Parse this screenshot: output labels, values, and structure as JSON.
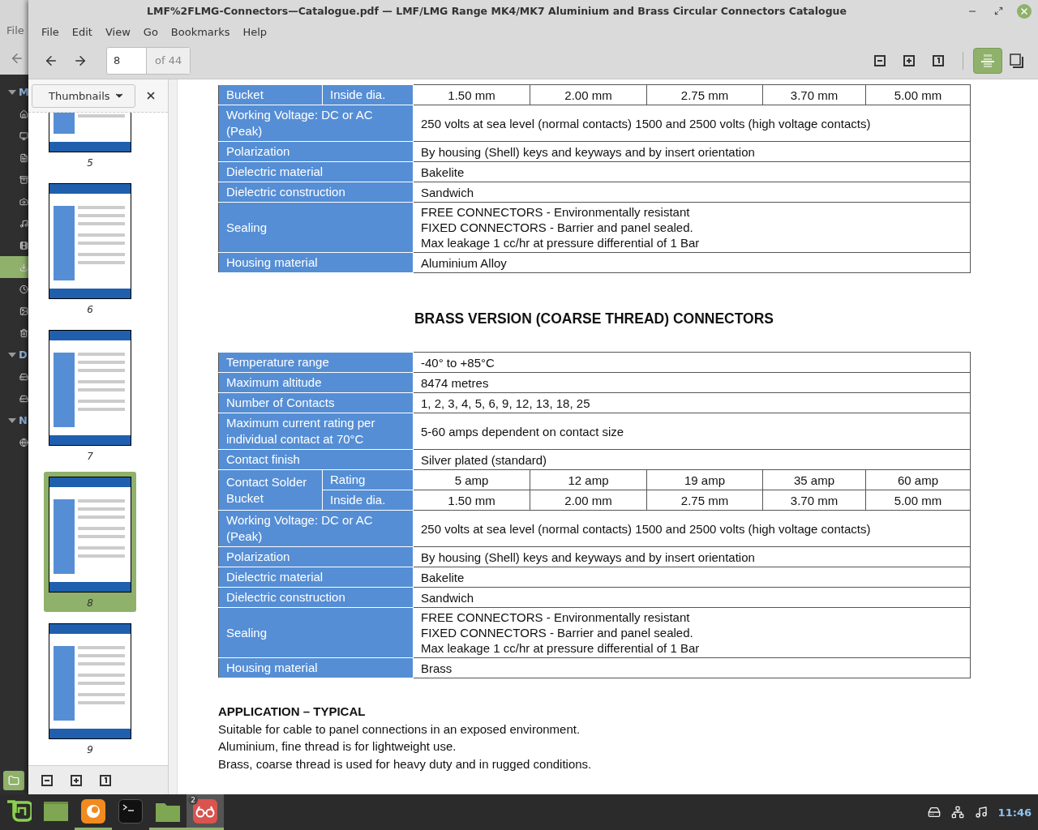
{
  "background_window": {
    "menu_item": "File",
    "sidebar": [
      {
        "kind": "header",
        "label": "M"
      },
      {
        "kind": "place",
        "selected": false
      },
      {
        "kind": "place",
        "selected": false
      },
      {
        "kind": "place",
        "selected": false
      },
      {
        "kind": "place",
        "selected": false
      },
      {
        "kind": "place",
        "selected": false
      },
      {
        "kind": "place",
        "selected": false
      },
      {
        "kind": "place",
        "selected": false
      },
      {
        "kind": "place",
        "selected": true
      },
      {
        "kind": "place",
        "selected": false
      },
      {
        "kind": "place",
        "selected": false
      },
      {
        "kind": "place",
        "selected": false
      },
      {
        "kind": "header",
        "label": "D"
      },
      {
        "kind": "place",
        "selected": false
      },
      {
        "kind": "place",
        "selected": false
      },
      {
        "kind": "header",
        "label": "N"
      },
      {
        "kind": "place",
        "selected": false
      }
    ]
  },
  "window": {
    "title": "LMF%2FLMG-Connectors—Catalogue.pdf — LMF/LMG Range MK4/MK7 Aluminium and Brass Circular Connectors Catalogue",
    "menu": [
      "File",
      "Edit",
      "View",
      "Go",
      "Bookmarks",
      "Help"
    ],
    "toolbar": {
      "page": "8",
      "page_total": "of 44",
      "continuous_selected": true
    },
    "sidebar": {
      "selector": "Thumbnails",
      "thumbnails": [
        {
          "page": "5",
          "selected": false
        },
        {
          "page": "6",
          "selected": false
        },
        {
          "page": "7",
          "selected": false
        },
        {
          "page": "8",
          "selected": true
        },
        {
          "page": "9",
          "selected": false
        }
      ]
    },
    "document": {
      "table_1": {
        "rows": [
          {
            "kind": "split",
            "label": "Bucket",
            "subrows": [
              {
                "label": "Inside dia.",
                "values": [
                  "1.50 mm",
                  "2.00 mm",
                  "2.75 mm",
                  "3.70 mm",
                  "5.00 mm"
                ]
              }
            ]
          },
          {
            "kind": "plain",
            "label": "Working Voltage: DC or  AC (Peak)",
            "lines": [
              "250 volts at sea level (normal contacts) 1500 and 2500 volts (high voltage contacts)"
            ]
          },
          {
            "kind": "plain",
            "label": "Polarization",
            "lines": [
              "By housing (Shell) keys and keyways and by insert orientation"
            ]
          },
          {
            "kind": "plain",
            "label": "Dielectric material",
            "lines": [
              "Bakelite"
            ]
          },
          {
            "kind": "plain",
            "label": "Dielectric construction",
            "lines": [
              "Sandwich"
            ]
          },
          {
            "kind": "plain",
            "label": "Sealing",
            "lines": [
              "FREE CONNECTORS - Environmentally resistant",
              "FIXED CONNECTORS - Barrier and panel sealed.",
              "Max leakage 1 cc/hr at pressure differential of 1 Bar"
            ]
          },
          {
            "kind": "plain",
            "label": "Housing material",
            "lines": [
              "Aluminium Alloy"
            ]
          }
        ]
      },
      "heading": "BRASS VERSION (COARSE THREAD) CONNECTORS",
      "table_2": {
        "rows": [
          {
            "kind": "plain",
            "label": "Temperature range",
            "lines": [
              "-40° to +85°C"
            ]
          },
          {
            "kind": "plain",
            "label": "Maximum altitude",
            "lines": [
              "8474 metres"
            ]
          },
          {
            "kind": "plain",
            "label": "Number of Contacts",
            "lines": [
              "1, 2, 3, 4, 5, 6, 9, 12, 13, 18, 25"
            ]
          },
          {
            "kind": "plain",
            "label": "Maximum current rating per individual contact at 70°C",
            "lines": [
              "5-60 amps dependent on contact size"
            ]
          },
          {
            "kind": "plain",
            "label": "Contact finish",
            "lines": [
              "Silver plated (standard)"
            ]
          },
          {
            "kind": "split",
            "label": "Contact Solder Bucket",
            "subrows": [
              {
                "label": "Rating",
                "values": [
                  "5 amp",
                  "12 amp",
                  "19 amp",
                  "35 amp",
                  "60 amp"
                ]
              },
              {
                "label": "Inside dia.",
                "values": [
                  "1.50 mm",
                  "2.00 mm",
                  "2.75 mm",
                  "3.70 mm",
                  "5.00 mm"
                ]
              }
            ]
          },
          {
            "kind": "plain",
            "label": "Working Voltage: DC or  AC (Peak)",
            "lines": [
              "250 volts at sea level (normal contacts) 1500 and 2500 volts (high voltage contacts)"
            ]
          },
          {
            "kind": "plain",
            "label": "Polarization",
            "lines": [
              "By housing (Shell) keys and keyways and by insert orientation"
            ]
          },
          {
            "kind": "plain",
            "label": "Dielectric material",
            "lines": [
              "Bakelite"
            ]
          },
          {
            "kind": "plain",
            "label": "Dielectric construction",
            "lines": [
              "Sandwich"
            ]
          },
          {
            "kind": "plain",
            "label": "Sealing",
            "lines": [
              "FREE CONNECTORS - Environmentally resistant",
              "FIXED CONNECTORS - Barrier and panel sealed.",
              "Max leakage 1 cc/hr at pressure differential of 1 Bar"
            ]
          },
          {
            "kind": "plain",
            "label": "Housing material",
            "lines": [
              "Brass"
            ]
          }
        ]
      },
      "application": {
        "heading": "APPLICATION – TYPICAL",
        "lines": [
          "Suitable for cable to panel connections in an exposed environment.",
          "Aluminium, fine thread is for lightweight use.",
          "Brass, coarse thread is used for heavy duty and in rugged conditions."
        ]
      }
    }
  },
  "taskbar": {
    "apps": [
      {
        "kind": "menu",
        "running": false,
        "selected": false
      },
      {
        "kind": "files",
        "running": false,
        "selected": false
      },
      {
        "kind": "browser",
        "running": true,
        "selected": false
      },
      {
        "kind": "terminal",
        "running": false,
        "selected": false
      },
      {
        "kind": "folder",
        "running": true,
        "selected": false
      },
      {
        "kind": "viewer",
        "running": true,
        "selected": true,
        "badge": "2"
      }
    ],
    "clock": "11:46"
  }
}
